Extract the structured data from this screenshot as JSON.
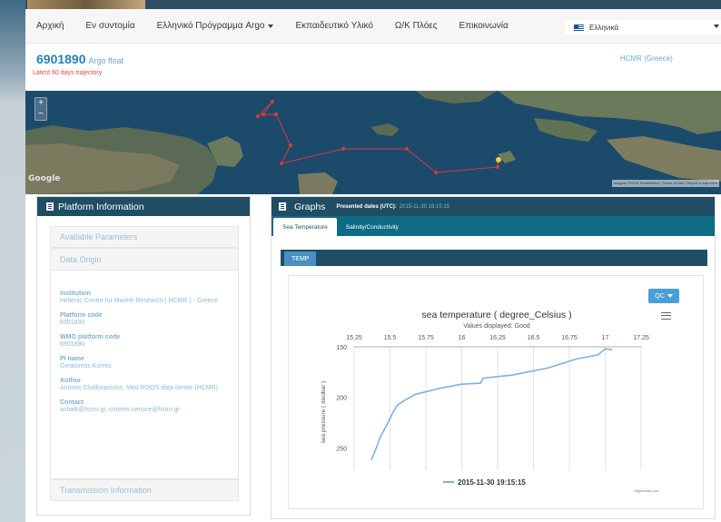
{
  "nav": {
    "items": [
      "Αρχική",
      "Εν συντομία",
      "Ελληνικό Πρόγραμμα Argo",
      "Εκπαιδευτικό Υλικό",
      "Ω/Κ Πλόες",
      "Επικοινωνία"
    ],
    "language": "Ελληνικά"
  },
  "header": {
    "float_id": "6901890",
    "float_type": "Argo float",
    "trajectory_label": "Latest 60 days trajectory",
    "institution_link": "HCMR (Greece)"
  },
  "map": {
    "zoom_in": "+",
    "zoom_out": "−",
    "logo": "Google",
    "attribution": "Imagery ©2015 TerraMetrics | Terms of Use | Report a map error"
  },
  "platform": {
    "title": "Platform Information",
    "sections": [
      "Available Parameters",
      "Data Origin",
      "Transmission Information"
    ],
    "fields": [
      {
        "label": "Institution",
        "value": "Hellenic Centre for Marine Research ( HCMR ) - Greece"
      },
      {
        "label": "Platform code",
        "value": "6901890"
      },
      {
        "label": "WMO platform code",
        "value": "6901890"
      },
      {
        "label": "PI name",
        "value": "Gerasimos Korres"
      },
      {
        "label": "Author",
        "value": "Antonis Chalkiopoulos, Med ROOS data center (HCMR)"
      },
      {
        "label": "Contact",
        "value": "achalk@hcmr.gr, cmems-service@hcmr.gr"
      }
    ]
  },
  "graphs": {
    "title": "Graphs",
    "presented_label": "Presented dates (UTC):",
    "presented_value": "2015-11-30 19:15:15",
    "tabs": [
      "Sea Temperature",
      "Salinity/Conductivity"
    ],
    "sub_tab": "TEMP",
    "qc_label": "QC",
    "credit": "Highcharts.com"
  },
  "colors": {
    "header_bar": "#1f4d63",
    "tab_bar": "#0e6b86",
    "accent": "#2a7fb8",
    "series": "#7fb0e0",
    "trajectory": "#d93a3a"
  },
  "chart_data": {
    "type": "line",
    "title": "sea temperature ( degree_Celsius )",
    "subtitle": "Values displayed: Good",
    "xlabel": "",
    "ylabel": "sea pressure ( decibar )",
    "x_axis_position": "top",
    "y_reversed": true,
    "xlim": [
      15.25,
      17.25
    ],
    "ylim": [
      150,
      265
    ],
    "x_ticks": [
      "15.25",
      "15.5",
      "15.75",
      "16",
      "16.25",
      "16.5",
      "16.75",
      "17",
      "17.25"
    ],
    "y_ticks": [
      "150",
      "200",
      "250"
    ],
    "legend": "bottom-center",
    "series": [
      {
        "name": "2015-11-30 19:15:15",
        "points": [
          [
            17.05,
            153
          ],
          [
            17.0,
            152
          ],
          [
            16.95,
            158
          ],
          [
            16.8,
            162
          ],
          [
            16.6,
            171
          ],
          [
            16.35,
            178
          ],
          [
            16.15,
            181
          ],
          [
            16.13,
            186
          ],
          [
            16.0,
            187
          ],
          [
            15.85,
            191
          ],
          [
            15.68,
            197
          ],
          [
            15.6,
            203
          ],
          [
            15.55,
            208
          ],
          [
            15.52,
            215
          ],
          [
            15.49,
            224
          ],
          [
            15.46,
            232
          ],
          [
            15.43,
            240
          ],
          [
            15.41,
            248
          ],
          [
            15.39,
            255
          ],
          [
            15.37,
            262
          ]
        ]
      }
    ]
  }
}
